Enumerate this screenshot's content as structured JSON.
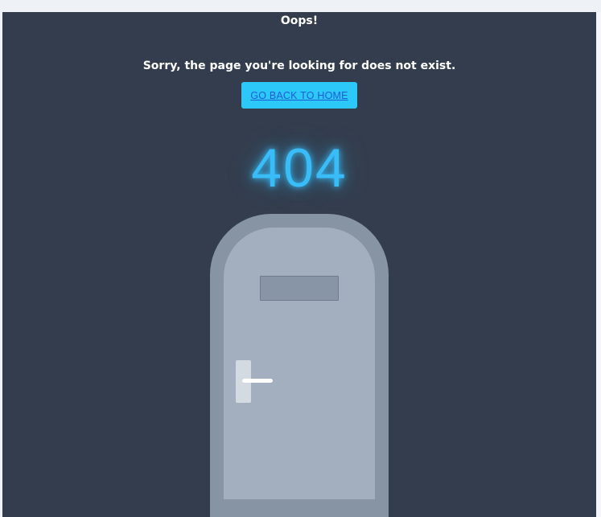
{
  "page": {
    "title": "Oops!",
    "message": "Sorry, the page you're looking for does not exist.",
    "home_button_label": "GO BACK TO HOME",
    "error_code": "404"
  },
  "colors": {
    "background": "#343d4d",
    "accent": "#2cc8f8",
    "glow": "#38bdf8",
    "link": "#1e5bd8",
    "door": "#a3afbf",
    "door_frame": "#8694a4"
  },
  "illustration": {
    "icon": "door-icon"
  }
}
